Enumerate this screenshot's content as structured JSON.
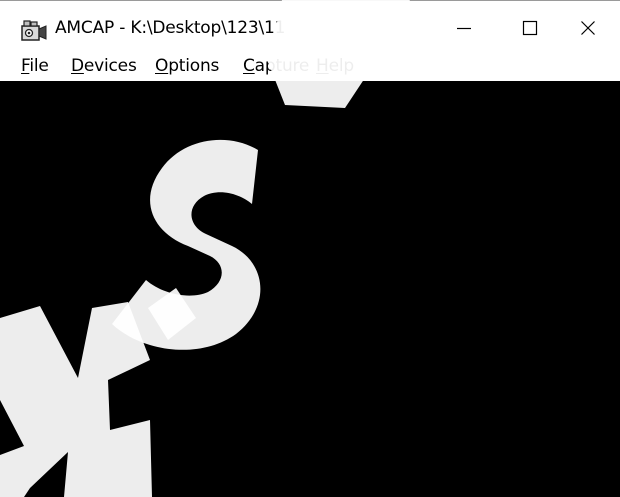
{
  "window": {
    "title": "AMCAP - K:\\Desktop\\123\\11",
    "app_icon": "camera-icon",
    "controls": {
      "minimize_icon": "minimize-icon",
      "maximize_icon": "maximize-icon",
      "close_icon": "close-icon"
    }
  },
  "menu": {
    "items": [
      {
        "mnemonic": "F",
        "rest": "ile"
      },
      {
        "mnemonic": "D",
        "rest": "evices"
      },
      {
        "mnemonic": "O",
        "rest": "ptions"
      },
      {
        "mnemonic": "C",
        "rest": "apture"
      },
      {
        "mnemonic": "H",
        "rest": "elp"
      }
    ]
  },
  "preview": {
    "background": "#000000"
  },
  "watermark": {
    "color": "#ffffff"
  }
}
